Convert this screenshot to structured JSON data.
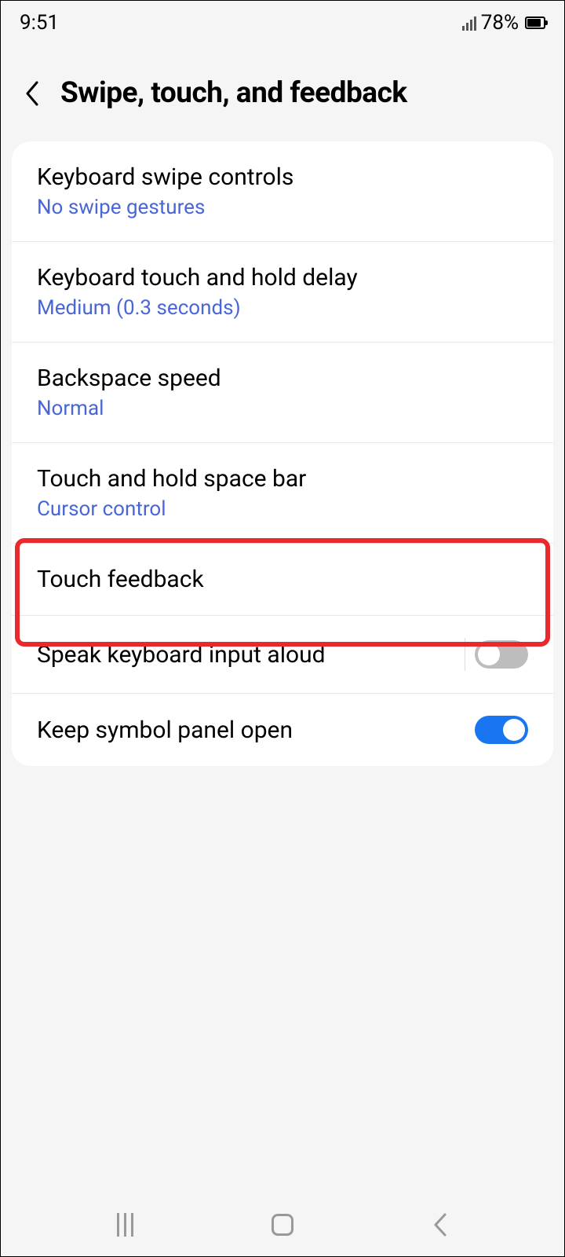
{
  "statusBar": {
    "time": "9:51",
    "battery": "78%"
  },
  "header": {
    "title": "Swipe, touch, and feedback"
  },
  "settings": [
    {
      "title": "Keyboard swipe controls",
      "value": "No swipe gestures"
    },
    {
      "title": "Keyboard touch and hold delay",
      "value": "Medium (0.3 seconds)"
    },
    {
      "title": "Backspace speed",
      "value": "Normal"
    },
    {
      "title": "Touch and hold space bar",
      "value": "Cursor control"
    },
    {
      "title": "Touch feedback"
    },
    {
      "title": "Speak keyboard input aloud",
      "toggle": false
    },
    {
      "title": "Keep symbol panel open",
      "toggle": true
    }
  ]
}
